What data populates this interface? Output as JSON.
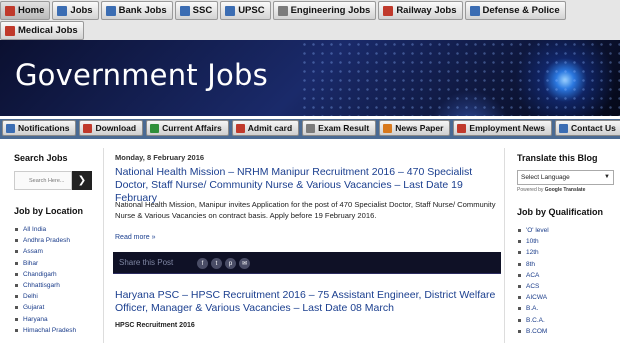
{
  "topnav": {
    "row1": [
      {
        "label": "Home",
        "icon": "home-icon"
      },
      {
        "label": "Jobs",
        "icon": "jobs-icon"
      },
      {
        "label": "Bank Jobs",
        "icon": "bank-icon"
      },
      {
        "label": "SSC",
        "icon": "ssc-icon"
      },
      {
        "label": "UPSC",
        "icon": "upsc-icon"
      },
      {
        "label": "Engineering Jobs",
        "icon": "gear-icon"
      },
      {
        "label": "Railway Jobs",
        "icon": "train-icon"
      },
      {
        "label": "Defense & Police",
        "icon": "shield-icon"
      }
    ],
    "row2": [
      {
        "label": "Medical Jobs",
        "icon": "medical-icon"
      }
    ]
  },
  "banner": {
    "title": "Government Jobs"
  },
  "subnav": [
    {
      "label": "Notifications",
      "icon": "bell-icon"
    },
    {
      "label": "Download",
      "icon": "download-icon"
    },
    {
      "label": "Current Affairs",
      "icon": "globe-icon"
    },
    {
      "label": "Admit card",
      "icon": "card-icon"
    },
    {
      "label": "Exam Result",
      "icon": "result-icon"
    },
    {
      "label": "News Paper",
      "icon": "newspaper-icon"
    },
    {
      "label": "Employment News",
      "icon": "news-icon"
    },
    {
      "label": "Contact Us",
      "icon": "mail-icon"
    }
  ],
  "left": {
    "search_title": "Search Jobs",
    "search_placeholder": "Search Here...",
    "location_title": "Job by Location",
    "locations": [
      "All India",
      "Andhra Pradesh",
      "Assam",
      "Bihar",
      "Chandigarh",
      "Chhattisgarh",
      "Delhi",
      "Gujarat",
      "Haryana",
      "Himachal Pradesh"
    ]
  },
  "main": {
    "date": "Monday, 8 February 2016",
    "post1_title": "National Health Mission – NRHM Manipur Recruitment 2016 – 470 Specialist Doctor, Staff Nurse/ Community Nurse & Various Vacancies – Last Date 19 February",
    "post1_body": "National Health Mission, Manipur invites Application for the post of 470 Specialist Doctor, Staff Nurse/ Community Nurse & Various Vacancies on contract basis. Apply before 19 February 2016.",
    "read_more": "Read more »",
    "share_label": "Share this Post",
    "post2_title": "Haryana PSC – HPSC Recruitment 2016 – 75 Assistant Engineer, District Welfare Officer, Manager & Various Vacancies – Last Date 08 March",
    "post2_sub": "HPSC Recruitment 2016"
  },
  "right": {
    "translate_title": "Translate this Blog",
    "language_select": "Select Language",
    "powered_by": "Powered by",
    "powered_brand": "Google Translate",
    "qual_title": "Job by Qualification",
    "qualifications": [
      "'O' level",
      "10th",
      "12th",
      "8th",
      "ACA",
      "ACS",
      "AICWA",
      "B.A.",
      "B.C.A.",
      "B.COM"
    ]
  }
}
